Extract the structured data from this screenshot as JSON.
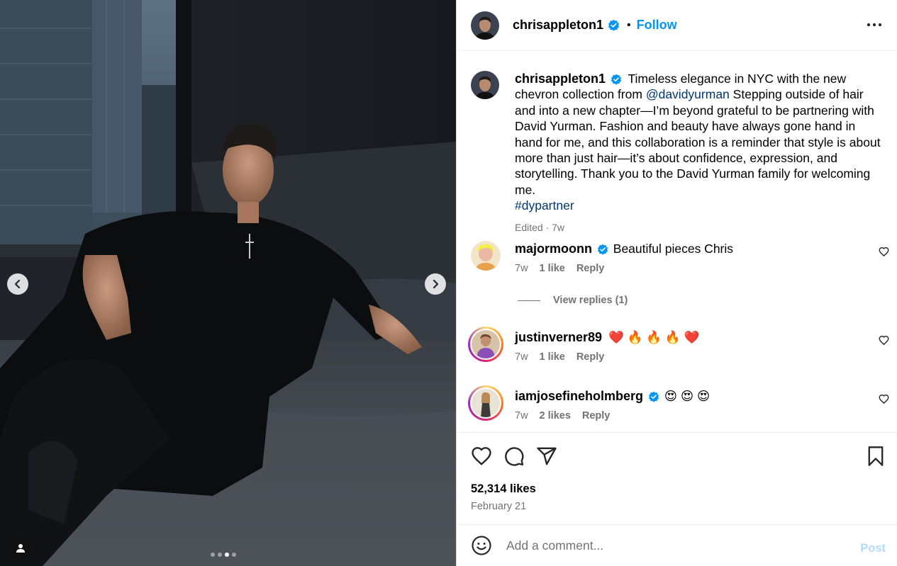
{
  "post": {
    "author": "chrisappleton1",
    "follow_label": "Follow",
    "more_icon": "more-options-icon",
    "carousel": {
      "slide_count": 4,
      "active_slide": 3
    }
  },
  "caption": {
    "author": "chrisappleton1",
    "text_1": "Timeless elegance in NYC with the new chevron collection from",
    "mention": "@davidyurman",
    "text_2": "Stepping outside of hair and into a new chapter—I’m beyond grateful to be partnering with David Yurman. Fashion and beauty have always gone hand in hand for me, and this collaboration is a reminder that style is about more than just hair—it’s about confidence, expression, and storytelling. Thank you to the David Yurman family for welcoming me.",
    "hashtag": "#dypartner",
    "meta": "Edited · 7w"
  },
  "comments": [
    {
      "user": "majormoonn",
      "verified": true,
      "text": "Beautiful pieces Chris",
      "time": "7w",
      "likes": "1 like",
      "reply": "Reply"
    },
    {
      "user": "justinverner89",
      "verified": false,
      "text": "❤️ 🔥 🔥 🔥 ❤️",
      "time": "7w",
      "likes": "1 like",
      "reply": "Reply"
    },
    {
      "user": "iamjosefineholmberg",
      "verified": true,
      "text": "😍 😍 😍",
      "time": "7w",
      "likes": "2 likes",
      "reply": "Reply"
    }
  ],
  "view_replies": "View replies (1)",
  "likes": "52,314 likes",
  "date": "February 21",
  "add_comment": {
    "placeholder": "Add a comment...",
    "post_label": "Post"
  },
  "colors": {
    "accent": "#0095f6",
    "verified": "#0095f6",
    "link": "#00376b",
    "muted": "#737373"
  }
}
